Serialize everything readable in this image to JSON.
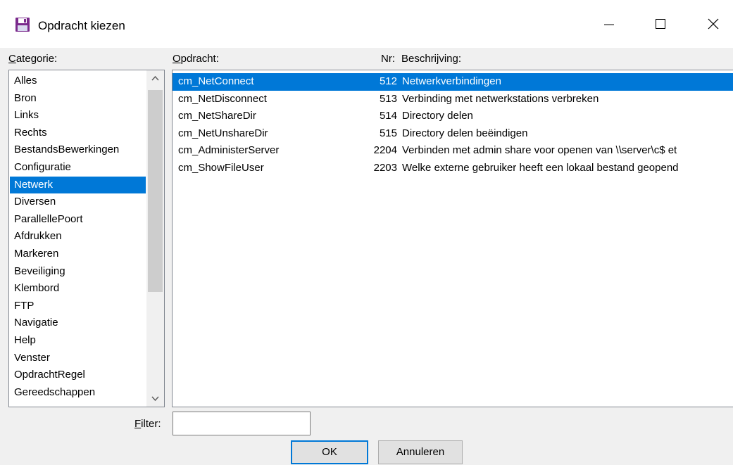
{
  "window": {
    "title": "Opdracht kiezen",
    "icon": "floppy-disk-icon",
    "controls": [
      "minimize-icon",
      "maximize-icon",
      "close-icon"
    ]
  },
  "headers": {
    "category": "Categorie:",
    "command": "Opdracht:",
    "nr": "Nr:",
    "description": "Beschrijving:"
  },
  "categories": [
    "Alles",
    "Bron",
    "Links",
    "Rechts",
    "BestandsBewerkingen",
    "Configuratie",
    "Netwerk",
    "Diversen",
    "ParallellePoort",
    "Afdrukken",
    "Markeren",
    "Beveiliging",
    "Klembord",
    "FTP",
    "Navigatie",
    "Help",
    "Venster",
    "OpdrachtRegel",
    "Gereedschappen"
  ],
  "selected_category": "Netwerk",
  "commands": [
    {
      "name": "cm_NetConnect",
      "nr": "512",
      "desc": "Netwerkverbindingen"
    },
    {
      "name": "cm_NetDisconnect",
      "nr": "513",
      "desc": "Verbinding met netwerkstations verbreken"
    },
    {
      "name": "cm_NetShareDir",
      "nr": "514",
      "desc": "Directory delen"
    },
    {
      "name": "cm_NetUnshareDir",
      "nr": "515",
      "desc": "Directory delen beëindigen"
    },
    {
      "name": "cm_AdministerServer",
      "nr": "2204",
      "desc": "Verbinden met admin share voor openen van \\\\server\\c$ et"
    },
    {
      "name": "cm_ShowFileUser",
      "nr": "2203",
      "desc": "Welke externe gebruiker heeft een lokaal bestand geopend"
    }
  ],
  "selected_command": "cm_NetConnect",
  "filter": {
    "label": "Filter:",
    "value": ""
  },
  "buttons": {
    "ok": "OK",
    "cancel": "Annuleren"
  },
  "colors": {
    "selection": "#0078d7",
    "window_bg": "#f0f0f0"
  }
}
